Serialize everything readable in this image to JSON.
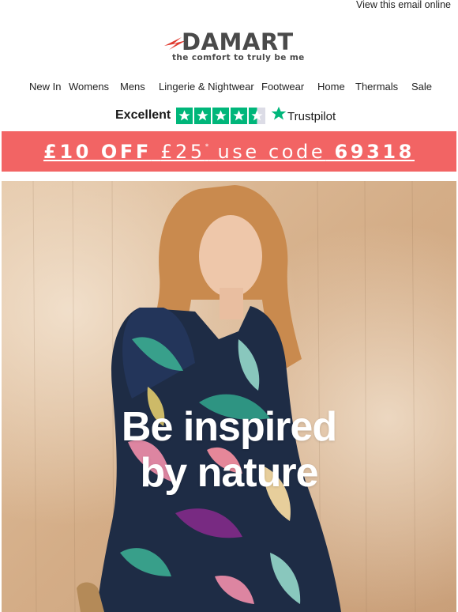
{
  "header": {
    "view_online": "View this email online"
  },
  "brand": {
    "name": "DAMART",
    "tagline": "the comfort to truly be me",
    "accent": "#e03a2f"
  },
  "nav": {
    "items": [
      "New In",
      "Womens",
      "Mens",
      "Lingerie & Nightwear",
      "Footwear",
      "Home",
      "Thermals",
      "Sale"
    ]
  },
  "trust": {
    "rating_word": "Excellent",
    "stars": 4.5,
    "provider": "Trustpilot",
    "star_color": "#00b67a"
  },
  "promo": {
    "amount": "£10 OFF",
    "threshold": "£25",
    "asterisk": "*",
    "use_code": "use code",
    "code": "69318",
    "background": "#f26464"
  },
  "hero": {
    "line1": "Be inspired",
    "line2": "by nature"
  }
}
